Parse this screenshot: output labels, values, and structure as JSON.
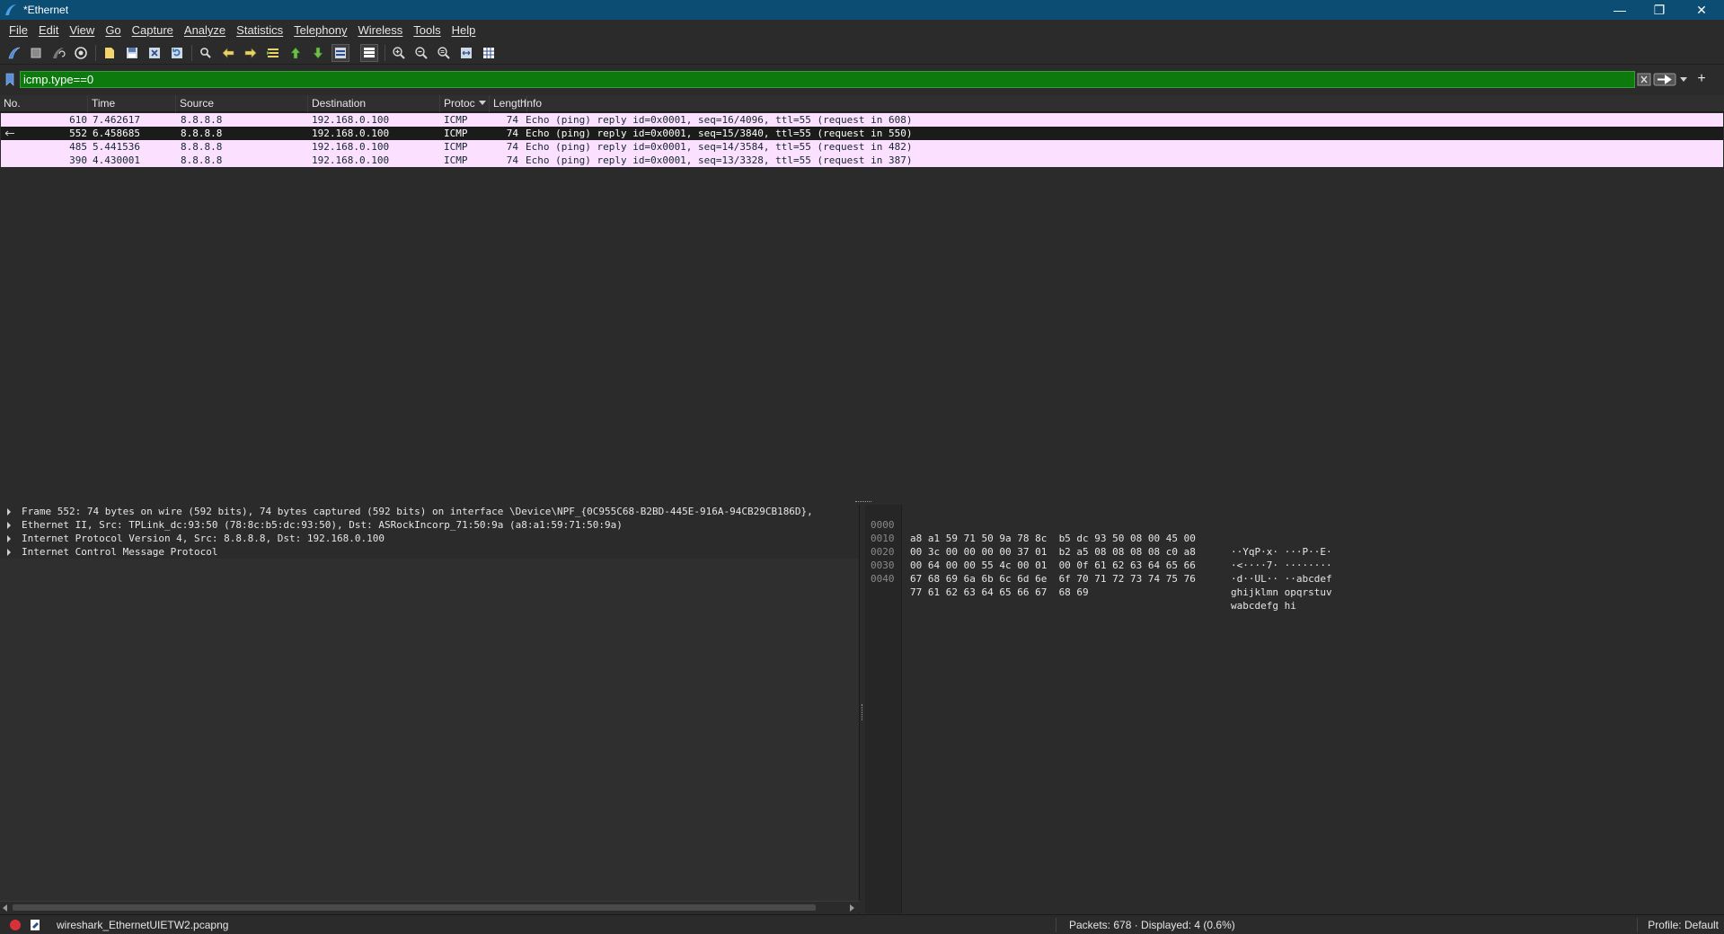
{
  "window": {
    "title": "*Ethernet",
    "controls": {
      "minimize": "—",
      "restore": "❐",
      "close": "✕"
    }
  },
  "menu": {
    "items": [
      "File",
      "Edit",
      "View",
      "Go",
      "Capture",
      "Analyze",
      "Statistics",
      "Telephony",
      "Wireless",
      "Tools",
      "Help"
    ]
  },
  "toolbar": {
    "icons": [
      "shark-fin-start-icon",
      "stop-icon",
      "restart-icon",
      "capture-options-icon",
      "open-file-icon",
      "save-file-icon",
      "close-file-icon",
      "reload-icon",
      "find-icon",
      "go-back-icon",
      "go-forward-icon",
      "go-to-packet-icon",
      "go-first-icon",
      "go-last-icon",
      "autoscroll-icon",
      "colorize-icon",
      "zoom-in-icon",
      "zoom-out-icon",
      "zoom-normal-icon",
      "resize-columns-icon",
      "layout-icon"
    ]
  },
  "filter": {
    "value": "icmp.type==0",
    "accent": "#0c7a0c"
  },
  "packet_list": {
    "columns": [
      "No.",
      "Time",
      "Source",
      "Destination",
      "Protoc",
      "Length",
      "Info"
    ],
    "sorted_column": "Protoc",
    "rows": [
      {
        "no": "610",
        "time": "7.462617",
        "source": "8.8.8.8",
        "destination": "192.168.0.100",
        "protocol": "ICMP",
        "length": "74",
        "info": "Echo (ping) reply    id=0x0001, seq=16/4096, ttl=55 (request in 608)",
        "selected": false
      },
      {
        "no": "552",
        "time": "6.458685",
        "source": "8.8.8.8",
        "destination": "192.168.0.100",
        "protocol": "ICMP",
        "length": "74",
        "info": "Echo (ping) reply    id=0x0001, seq=15/3840, ttl=55 (request in 550)",
        "selected": true
      },
      {
        "no": "485",
        "time": "5.441536",
        "source": "8.8.8.8",
        "destination": "192.168.0.100",
        "protocol": "ICMP",
        "length": "74",
        "info": "Echo (ping) reply    id=0x0001, seq=14/3584, ttl=55 (request in 482)",
        "selected": false
      },
      {
        "no": "390",
        "time": "4.430001",
        "source": "8.8.8.8",
        "destination": "192.168.0.100",
        "protocol": "ICMP",
        "length": "74",
        "info": "Echo (ping) reply    id=0x0001, seq=13/3328, ttl=55 (request in 387)",
        "selected": false
      }
    ],
    "row_color": "#fce0ff"
  },
  "details": {
    "items": [
      "Frame 552: 74 bytes on wire (592 bits), 74 bytes captured (592 bits) on interface \\Device\\NPF_{0C955C68-B2BD-445E-916A-94CB29CB186D},",
      "Ethernet II, Src: TPLink_dc:93:50 (78:8c:b5:dc:93:50), Dst: ASRockIncorp_71:50:9a (a8:a1:59:71:50:9a)",
      "Internet Protocol Version 4, Src: 8.8.8.8, Dst: 192.168.0.100",
      "Internet Control Message Protocol"
    ]
  },
  "bytes": {
    "rows": [
      {
        "offset": "0000",
        "hex": "a8 a1 59 71 50 9a 78 8c  b5 dc 93 50 08 00 45 00",
        "ascii": "··YqP·x· ···P··E·"
      },
      {
        "offset": "0010",
        "hex": "00 3c 00 00 00 00 37 01  b2 a5 08 08 08 08 c0 a8",
        "ascii": "·<····7· ········"
      },
      {
        "offset": "0020",
        "hex": "00 64 00 00 55 4c 00 01  00 0f 61 62 63 64 65 66",
        "ascii": "·d··UL·· ··abcdef"
      },
      {
        "offset": "0030",
        "hex": "67 68 69 6a 6b 6c 6d 6e  6f 70 71 72 73 74 75 76",
        "ascii": "ghijklmn opqrstuv"
      },
      {
        "offset": "0040",
        "hex": "77 61 62 63 64 65 66 67  68 69",
        "ascii": "wabcdefg hi"
      }
    ]
  },
  "status": {
    "file": "wireshark_EthernetUIETW2.pcapng",
    "packets": "Packets: 678 · Displayed: 4 (0.6%)",
    "profile": "Profile: Default",
    "ready_color": "#d9313b"
  }
}
